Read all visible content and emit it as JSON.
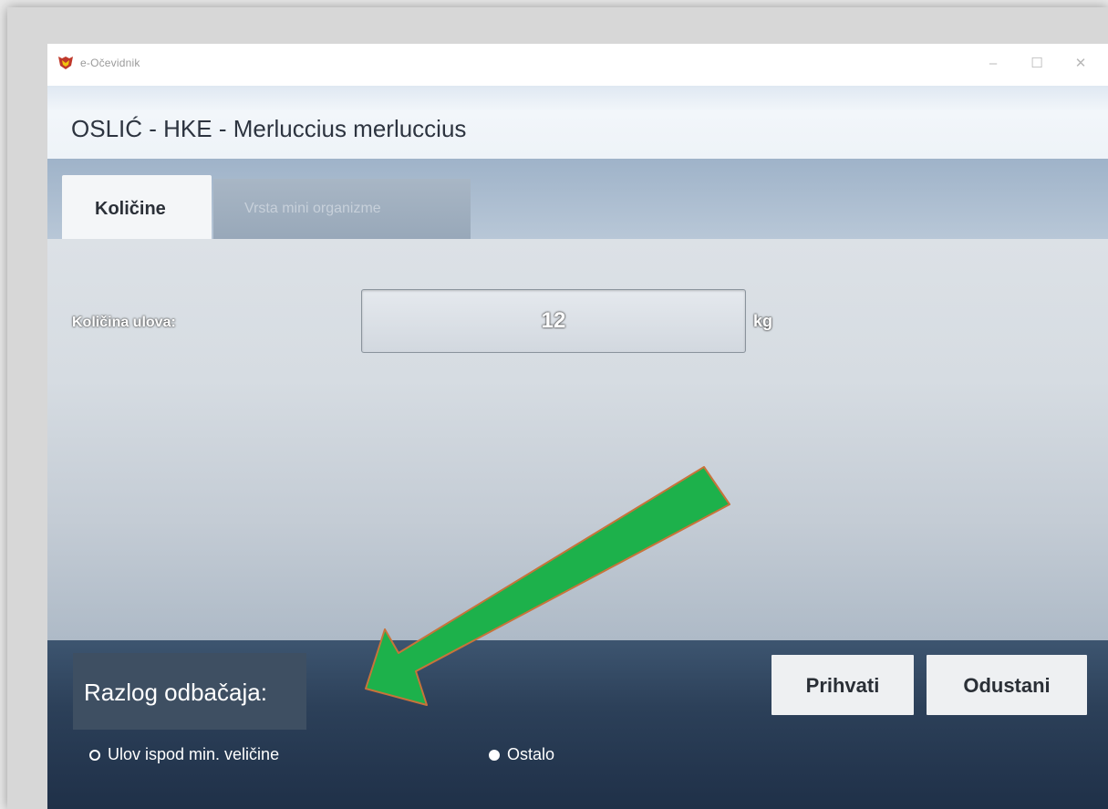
{
  "window": {
    "app_title": "e-Očevidnik",
    "controls": {
      "minimize": "–",
      "maximize": "☐",
      "close": "✕"
    }
  },
  "dialog": {
    "title": "OSLIĆ - HKE - Merluccius merluccius"
  },
  "tabs": [
    {
      "label": "Količine",
      "active": true
    },
    {
      "label": "Vrsta mini organizme",
      "active": false
    }
  ],
  "quantity": {
    "label": "Količina ulova:",
    "value": "12",
    "unit": "kg"
  },
  "footer": {
    "reason_label": "Razlog odbačaja:",
    "accept_label": "Prihvati",
    "cancel_label": "Odustani",
    "options": [
      {
        "label": "Ulov ispod min. veličine",
        "selected": false
      },
      {
        "label": "Ostalo",
        "selected": true
      }
    ]
  },
  "annotation": {
    "arrow_color": "#1db14b",
    "arrow_outline": "#c8733a"
  },
  "icons": {
    "app": "app-logo-icon"
  }
}
